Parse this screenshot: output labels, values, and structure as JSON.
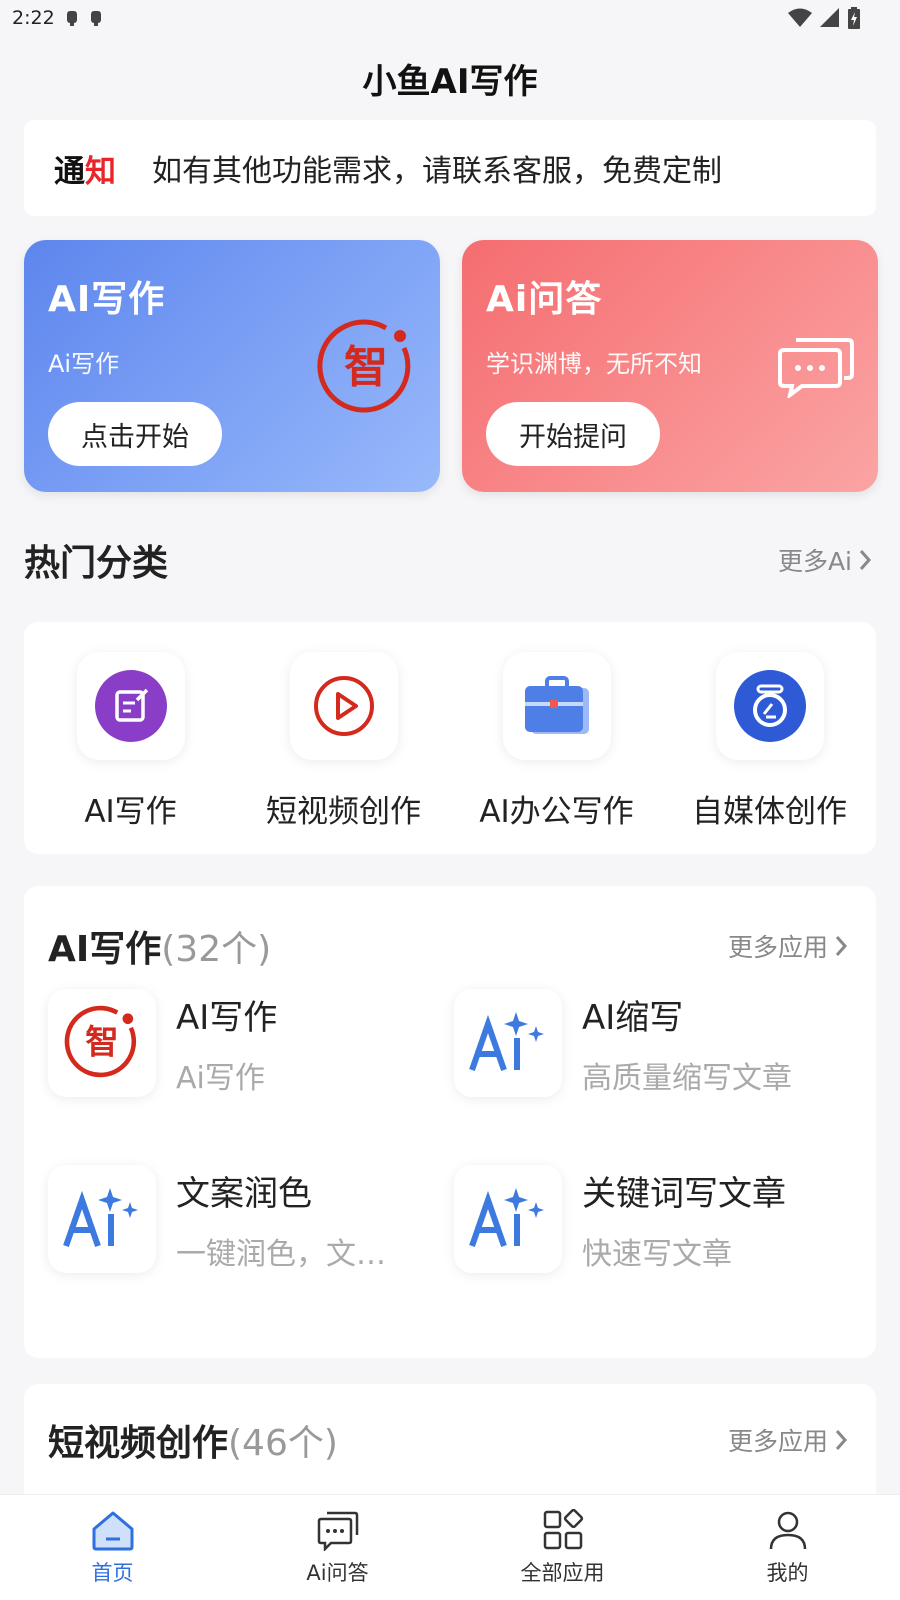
{
  "status": {
    "time": "2:22"
  },
  "header": {
    "title": "小鱼AI写作"
  },
  "notice": {
    "tag_a": "通",
    "tag_b": "知",
    "text": "如有其他功能需求，请联系客服，免费定制"
  },
  "hero": {
    "writing": {
      "title": "AI写作",
      "subtitle": "Ai写作",
      "button": "点击开始",
      "badge": "智"
    },
    "qa": {
      "title": "Ai问答",
      "subtitle": "学识渊博，无所不知",
      "button": "开始提问"
    }
  },
  "hot": {
    "title": "热门分类",
    "more": "更多Ai",
    "items": [
      {
        "label": "AI写作",
        "icon": "edit-icon"
      },
      {
        "label": "短视频创作",
        "icon": "play-icon"
      },
      {
        "label": "AI办公写作",
        "icon": "briefcase-icon"
      },
      {
        "label": "自媒体创作",
        "icon": "media-icon"
      }
    ]
  },
  "writing_apps": {
    "title": "AI写作",
    "count": "(32个)",
    "more": "更多应用",
    "items": [
      {
        "name": "AI写作",
        "desc": "Ai写作",
        "icon": "zhi-icon"
      },
      {
        "name": "AI缩写",
        "desc": "高质量缩写文章",
        "icon": "ai-sparkle-icon"
      },
      {
        "name": "文案润色",
        "desc": "一键润色，文…",
        "icon": "ai-sparkle-icon"
      },
      {
        "name": "关键词写文章",
        "desc": "快速写文章",
        "icon": "ai-sparkle-icon"
      }
    ]
  },
  "video_apps": {
    "title": "短视频创作",
    "count": "(46个)",
    "more": "更多应用"
  },
  "tabs": [
    {
      "label": "首页",
      "icon": "home-icon",
      "active": true
    },
    {
      "label": "Ai问答",
      "icon": "chat-icon",
      "active": false
    },
    {
      "label": "全部应用",
      "icon": "apps-icon",
      "active": false
    },
    {
      "label": "我的",
      "icon": "user-icon",
      "active": false
    }
  ],
  "colors": {
    "accent": "#2f6fe0",
    "hero_blue": "#5d86ee",
    "hero_red": "#f56d70",
    "notice_red": "#e8262a",
    "zhi_red": "#d42a1e"
  }
}
